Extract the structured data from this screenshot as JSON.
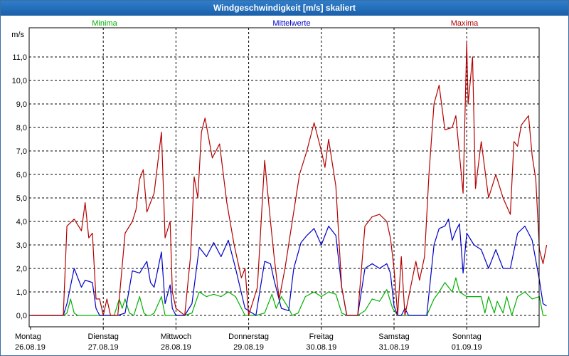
{
  "window": {
    "title": "Windgeschwindigkeit [m/s] skaliert"
  },
  "chart_data": {
    "type": "line",
    "title": "Windgeschwindigkeit [m/s] skaliert",
    "ylabel": "m/s",
    "xlabel": "",
    "ylim": [
      0,
      12
    ],
    "yticks": [
      "0,0",
      "1,0",
      "2,0",
      "3,0",
      "4,0",
      "5,0",
      "6,0",
      "7,0",
      "8,0",
      "9,0",
      "10,0",
      "11,0"
    ],
    "grid": true,
    "legend": "top",
    "x_range_days": [
      0,
      7
    ],
    "days": [
      {
        "name": "Montag",
        "date": "26.08.19",
        "x": 0
      },
      {
        "name": "Dienstag",
        "date": "27.08.19",
        "x": 1
      },
      {
        "name": "Mittwoch",
        "date": "28.08.19",
        "x": 2
      },
      {
        "name": "Donnerstag",
        "date": "29.08.19",
        "x": 3
      },
      {
        "name": "Freitag",
        "date": "30.08.19",
        "x": 4
      },
      {
        "name": "Samstag",
        "date": "31.08.19",
        "x": 5
      },
      {
        "name": "Sonntag",
        "date": "01.09.19",
        "x": 6
      }
    ],
    "series": [
      {
        "name": "Minima",
        "color": "#00b000",
        "points": [
          [
            0,
            0
          ],
          [
            0.45,
            0
          ],
          [
            0.5,
            0.1
          ],
          [
            0.55,
            0.7
          ],
          [
            0.6,
            0.1
          ],
          [
            0.65,
            0
          ],
          [
            0.98,
            0
          ],
          [
            1.08,
            0
          ],
          [
            1.15,
            0
          ],
          [
            1.22,
            0.7
          ],
          [
            1.26,
            0.3
          ],
          [
            1.3,
            0.7
          ],
          [
            1.36,
            0.1
          ],
          [
            1.42,
            0
          ],
          [
            1.5,
            0.8
          ],
          [
            1.56,
            0.1
          ],
          [
            1.6,
            0
          ],
          [
            1.65,
            0
          ],
          [
            1.7,
            0.1
          ],
          [
            1.8,
            0.8
          ],
          [
            1.85,
            0
          ],
          [
            1.9,
            0
          ],
          [
            2.0,
            0
          ],
          [
            2.12,
            0
          ],
          [
            2.22,
            0.1
          ],
          [
            2.32,
            1.0
          ],
          [
            2.42,
            0.8
          ],
          [
            2.52,
            0.9
          ],
          [
            2.62,
            0.8
          ],
          [
            2.72,
            1.0
          ],
          [
            2.82,
            0.8
          ],
          [
            2.95,
            0
          ],
          [
            3.1,
            0
          ],
          [
            3.22,
            0.1
          ],
          [
            3.32,
            0.9
          ],
          [
            3.38,
            0.3
          ],
          [
            3.45,
            0.8
          ],
          [
            3.55,
            0.3
          ],
          [
            3.6,
            0
          ],
          [
            3.68,
            0.1
          ],
          [
            3.78,
            0.8
          ],
          [
            3.9,
            1.0
          ],
          [
            4.0,
            0.8
          ],
          [
            4.1,
            1.0
          ],
          [
            4.2,
            0.9
          ],
          [
            4.28,
            0.1
          ],
          [
            4.35,
            0
          ],
          [
            4.5,
            0
          ],
          [
            4.6,
            0.2
          ],
          [
            4.7,
            0.7
          ],
          [
            4.8,
            0.6
          ],
          [
            4.9,
            1.1
          ],
          [
            4.98,
            0.3
          ],
          [
            5.05,
            0
          ],
          [
            5.45,
            0
          ],
          [
            5.55,
            0.7
          ],
          [
            5.62,
            1.0
          ],
          [
            5.7,
            1.4
          ],
          [
            5.8,
            1.0
          ],
          [
            5.85,
            1.6
          ],
          [
            5.9,
            1.0
          ],
          [
            6.0,
            0.8
          ],
          [
            6.2,
            0.8
          ],
          [
            6.25,
            0.1
          ],
          [
            6.3,
            0.8
          ],
          [
            6.38,
            0.1
          ],
          [
            6.42,
            0.6
          ],
          [
            6.5,
            0.1
          ],
          [
            6.55,
            0.8
          ],
          [
            6.62,
            0
          ],
          [
            6.7,
            0.8
          ],
          [
            6.8,
            1.0
          ],
          [
            6.9,
            0.7
          ],
          [
            7.0,
            0.8
          ],
          [
            7.05,
            0
          ],
          [
            7.1,
            0
          ]
        ]
      },
      {
        "name": "Mittelwerte",
        "color": "#0000c8",
        "points": [
          [
            0,
            0
          ],
          [
            0.45,
            0
          ],
          [
            0.5,
            0.5
          ],
          [
            0.6,
            2.0
          ],
          [
            0.7,
            1.2
          ],
          [
            0.75,
            1.5
          ],
          [
            0.85,
            1.4
          ],
          [
            0.9,
            0.3
          ],
          [
            0.95,
            0
          ],
          [
            1.1,
            0
          ],
          [
            1.2,
            0
          ],
          [
            1.3,
            0.1
          ],
          [
            1.4,
            1.9
          ],
          [
            1.5,
            1.8
          ],
          [
            1.6,
            2.3
          ],
          [
            1.65,
            1.4
          ],
          [
            1.7,
            1.2
          ],
          [
            1.8,
            2.7
          ],
          [
            1.85,
            0.5
          ],
          [
            1.92,
            1.3
          ],
          [
            1.95,
            0.3
          ],
          [
            2.0,
            0
          ],
          [
            2.12,
            0
          ],
          [
            2.22,
            0.5
          ],
          [
            2.32,
            2.9
          ],
          [
            2.42,
            2.5
          ],
          [
            2.52,
            3.1
          ],
          [
            2.62,
            2.5
          ],
          [
            2.72,
            3.2
          ],
          [
            2.82,
            2.0
          ],
          [
            2.95,
            0.3
          ],
          [
            3.1,
            0
          ],
          [
            3.22,
            2.3
          ],
          [
            3.3,
            2.2
          ],
          [
            3.35,
            1.5
          ],
          [
            3.45,
            0.3
          ],
          [
            3.55,
            0.2
          ],
          [
            3.62,
            2.0
          ],
          [
            3.72,
            3.1
          ],
          [
            3.8,
            3.4
          ],
          [
            3.9,
            3.7
          ],
          [
            4.0,
            3.0
          ],
          [
            4.1,
            3.8
          ],
          [
            4.2,
            3.4
          ],
          [
            4.28,
            1.2
          ],
          [
            4.35,
            0
          ],
          [
            4.5,
            0
          ],
          [
            4.6,
            2.0
          ],
          [
            4.7,
            2.2
          ],
          [
            4.8,
            2.0
          ],
          [
            4.9,
            2.2
          ],
          [
            4.95,
            1.8
          ],
          [
            5.0,
            0.4
          ],
          [
            5.05,
            0
          ],
          [
            5.1,
            0
          ],
          [
            5.15,
            0.3
          ],
          [
            5.2,
            0
          ],
          [
            5.45,
            0
          ],
          [
            5.55,
            3.0
          ],
          [
            5.62,
            3.7
          ],
          [
            5.7,
            3.8
          ],
          [
            5.75,
            4.1
          ],
          [
            5.8,
            3.2
          ],
          [
            5.85,
            3.6
          ],
          [
            5.9,
            3.9
          ],
          [
            5.95,
            1.8
          ],
          [
            6.0,
            3.5
          ],
          [
            6.1,
            3.0
          ],
          [
            6.2,
            2.8
          ],
          [
            6.3,
            2.0
          ],
          [
            6.4,
            2.8
          ],
          [
            6.5,
            2.0
          ],
          [
            6.6,
            2.0
          ],
          [
            6.7,
            3.5
          ],
          [
            6.8,
            3.8
          ],
          [
            6.9,
            3.2
          ],
          [
            7.0,
            1.5
          ],
          [
            7.05,
            0.5
          ],
          [
            7.1,
            0.4
          ]
        ]
      },
      {
        "name": "Maxima",
        "color": "#b40000",
        "points": [
          [
            0,
            0
          ],
          [
            0.45,
            0
          ],
          [
            0.5,
            3.8
          ],
          [
            0.6,
            4.1
          ],
          [
            0.7,
            3.6
          ],
          [
            0.75,
            4.8
          ],
          [
            0.8,
            3.3
          ],
          [
            0.85,
            3.5
          ],
          [
            0.9,
            0.7
          ],
          [
            0.95,
            0.7
          ],
          [
            1.0,
            0
          ],
          [
            1.05,
            0.7
          ],
          [
            1.1,
            0
          ],
          [
            1.2,
            0
          ],
          [
            1.3,
            3.5
          ],
          [
            1.4,
            4.0
          ],
          [
            1.45,
            4.5
          ],
          [
            1.5,
            5.8
          ],
          [
            1.55,
            6.2
          ],
          [
            1.6,
            4.4
          ],
          [
            1.7,
            5.2
          ],
          [
            1.8,
            7.8
          ],
          [
            1.85,
            3.3
          ],
          [
            1.92,
            4.0
          ],
          [
            1.95,
            1.0
          ],
          [
            2.0,
            0.3
          ],
          [
            2.12,
            0
          ],
          [
            2.2,
            2.5
          ],
          [
            2.25,
            5.9
          ],
          [
            2.3,
            5.0
          ],
          [
            2.35,
            7.8
          ],
          [
            2.4,
            8.4
          ],
          [
            2.5,
            6.7
          ],
          [
            2.6,
            7.3
          ],
          [
            2.7,
            4.8
          ],
          [
            2.8,
            3.0
          ],
          [
            2.9,
            1.6
          ],
          [
            2.95,
            2.0
          ],
          [
            3.0,
            0
          ],
          [
            3.12,
            1.2
          ],
          [
            3.22,
            6.6
          ],
          [
            3.3,
            4.0
          ],
          [
            3.35,
            2.5
          ],
          [
            3.42,
            0.7
          ],
          [
            3.5,
            2.0
          ],
          [
            3.6,
            4.0
          ],
          [
            3.7,
            6.0
          ],
          [
            3.8,
            7.0
          ],
          [
            3.9,
            8.2
          ],
          [
            4.0,
            7.0
          ],
          [
            4.05,
            6.3
          ],
          [
            4.1,
            7.5
          ],
          [
            4.2,
            5.5
          ],
          [
            4.28,
            1.2
          ],
          [
            4.35,
            0
          ],
          [
            4.5,
            0
          ],
          [
            4.6,
            3.8
          ],
          [
            4.7,
            4.2
          ],
          [
            4.8,
            4.3
          ],
          [
            4.9,
            4.0
          ],
          [
            4.95,
            3.3
          ],
          [
            5.0,
            2.0
          ],
          [
            5.05,
            0
          ],
          [
            5.1,
            2.5
          ],
          [
            5.15,
            0
          ],
          [
            5.3,
            2.3
          ],
          [
            5.35,
            1.5
          ],
          [
            5.42,
            2.5
          ],
          [
            5.48,
            6.0
          ],
          [
            5.55,
            9.0
          ],
          [
            5.62,
            9.8
          ],
          [
            5.7,
            7.9
          ],
          [
            5.8,
            8.0
          ],
          [
            5.85,
            8.5
          ],
          [
            5.95,
            5.2
          ],
          [
            6.0,
            11.6
          ],
          [
            6.02,
            9.0
          ],
          [
            6.08,
            11.0
          ],
          [
            6.12,
            5.4
          ],
          [
            6.2,
            7.4
          ],
          [
            6.3,
            5.0
          ],
          [
            6.4,
            6.0
          ],
          [
            6.5,
            5.0
          ],
          [
            6.6,
            4.3
          ],
          [
            6.65,
            7.4
          ],
          [
            6.7,
            7.2
          ],
          [
            6.75,
            8.1
          ],
          [
            6.85,
            8.5
          ],
          [
            6.9,
            6.8
          ],
          [
            6.95,
            5.8
          ],
          [
            7.0,
            2.8
          ],
          [
            7.05,
            2.2
          ],
          [
            7.1,
            3.0
          ]
        ]
      }
    ]
  }
}
